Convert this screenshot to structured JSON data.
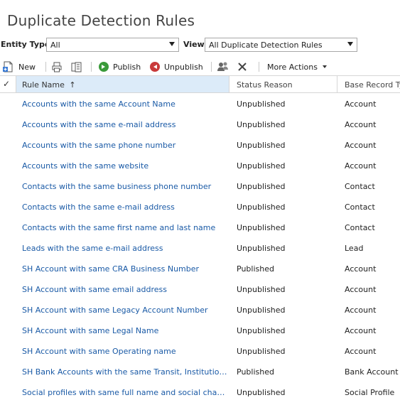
{
  "page": {
    "title": "Duplicate Detection Rules"
  },
  "filters": {
    "entity_type_label": "Entity Type:",
    "entity_type_value": "All",
    "view_label": "View:",
    "view_value": "All Duplicate Detection Rules"
  },
  "toolbar": {
    "new_label": "New",
    "publish_label": "Publish",
    "unpublish_label": "Unpublish",
    "more_actions_label": "More Actions"
  },
  "grid": {
    "columns": {
      "check": "✓",
      "rule_name": "Rule Name",
      "sort_indicator": "↑",
      "status_reason": "Status Reason",
      "base_record_type": "Base Record Typ"
    },
    "rows": [
      {
        "name": "Accounts with the same Account Name",
        "status": "Unpublished",
        "base": "Account"
      },
      {
        "name": "Accounts with the same e-mail address",
        "status": "Unpublished",
        "base": "Account"
      },
      {
        "name": "Accounts with the same phone number",
        "status": "Unpublished",
        "base": "Account"
      },
      {
        "name": "Accounts with the same website",
        "status": "Unpublished",
        "base": "Account"
      },
      {
        "name": "Contacts with the same business phone number",
        "status": "Unpublished",
        "base": "Contact"
      },
      {
        "name": "Contacts with the same e-mail address",
        "status": "Unpublished",
        "base": "Contact"
      },
      {
        "name": "Contacts with the same first name and last name",
        "status": "Unpublished",
        "base": "Contact"
      },
      {
        "name": "Leads with the same e-mail address",
        "status": "Unpublished",
        "base": "Lead"
      },
      {
        "name": "SH Account with same CRA Business Number",
        "status": "Published",
        "base": "Account"
      },
      {
        "name": "SH Account with same email address",
        "status": "Unpublished",
        "base": "Account"
      },
      {
        "name": "SH Account with same Legacy Account Number",
        "status": "Unpublished",
        "base": "Account"
      },
      {
        "name": "SH Account with same Legal Name",
        "status": "Unpublished",
        "base": "Account"
      },
      {
        "name": "SH Account with same Operating name",
        "status": "Unpublished",
        "base": "Account"
      },
      {
        "name": "SH Bank Accounts with the same Transit, Institution and A...",
        "status": "Published",
        "base": "Bank Account"
      },
      {
        "name": "Social profiles with same full name and social channel",
        "status": "Unpublished",
        "base": "Social Profile"
      }
    ]
  },
  "colors": {
    "link": "#1a5aa6",
    "header_highlight": "#dcebf9",
    "publish_green": "#3a9a3a",
    "unpublish_red": "#c93a3a"
  }
}
